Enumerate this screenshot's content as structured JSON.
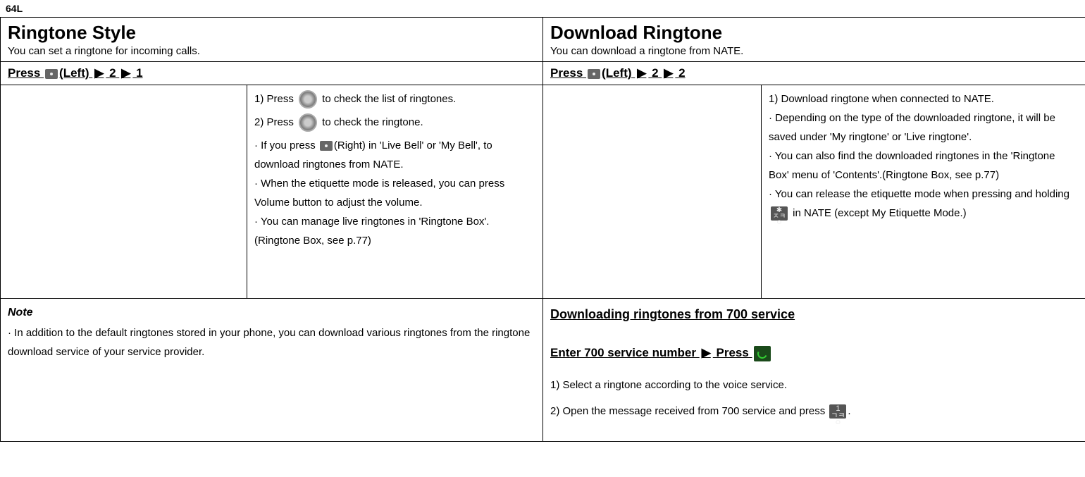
{
  "page_number": "64L",
  "left": {
    "heading": "Ringtone Style",
    "subhead": "You can set a ringtone for incoming calls.",
    "press_prefix": "Press ",
    "press_suffix1": "(Left)",
    "press_arrow": "▶",
    "press_num1": "2",
    "press_num2": "1",
    "step1_a": "1) Press ",
    "step1_b": " to check the list of ringtones.",
    "step2_a": "2) Press ",
    "step2_b": " to check the ringtone.",
    "bullet1_a": "· If you press ",
    "bullet1_b": "(Right) in 'Live Bell' or 'My Bell', to download ringtones from NATE.",
    "bullet2": "· When the etiquette mode is released, you can press Volume button to adjust the volume.",
    "bullet3": "· You can manage live ringtones in 'Ringtone Box'. (Ringtone Box, see p.77)",
    "note_label": "Note",
    "note_text": "· In addition to the default ringtones stored in your phone, you can download various ringtones from the ringtone download service of your service provider."
  },
  "right": {
    "heading": "Download Ringtone",
    "subhead": "You can download a ringtone from NATE.",
    "press_prefix": "Press ",
    "press_suffix1": "(Left)",
    "press_arrow": "▶",
    "press_num1": "2",
    "press_num2": "2",
    "step1": "1) Download ringtone when connected to NATE.",
    "bullet1": "· Depending on the type of the downloaded ringtone, it will be saved under 'My ringtone' or 'Live ringtone'.",
    "bullet2": "· You can also find the downloaded ringtones in the 'Ringtone Box' menu of 'Contents'.(Ringtone Box, see p.77)",
    "bullet3_a": "· You can release the etiquette mode when pressing and holding ",
    "bullet3_b": " in NATE (except My Etiquette Mode.)",
    "sub_heading": "Downloading ringtones from 700 service",
    "enter_a": "Enter 700 service number",
    "enter_arrow": "▶",
    "enter_b": "Press ",
    "step_r1": "1) Select a ringtone according to the voice service.",
    "step_r2_a": "2) Open the message received from 700 service and press ",
    "step_r2_b": "."
  }
}
